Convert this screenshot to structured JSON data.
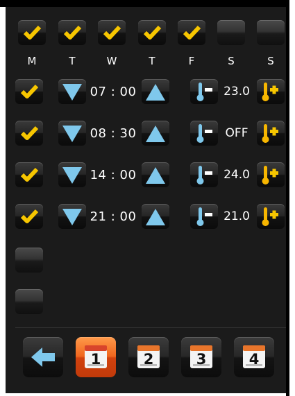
{
  "days": [
    "M",
    "T",
    "W",
    "T",
    "F",
    "S",
    "S"
  ],
  "day_checked": [
    true,
    true,
    true,
    true,
    true,
    false,
    false
  ],
  "schedule": [
    {
      "enabled": true,
      "time": "07 : 00",
      "temp": "23.0"
    },
    {
      "enabled": true,
      "time": "08 : 30",
      "temp": "OFF"
    },
    {
      "enabled": true,
      "time": "14 : 00",
      "temp": "24.0"
    },
    {
      "enabled": true,
      "time": "21 : 00",
      "temp": "21.0"
    }
  ],
  "extra_slots_enabled": [
    false,
    false
  ],
  "tabs": [
    {
      "icon": "back-arrow-icon"
    },
    {
      "icon": "calendar-icon",
      "label": "1",
      "active": true
    },
    {
      "icon": "calendar-icon",
      "label": "2",
      "active": false
    },
    {
      "icon": "calendar-icon",
      "label": "3",
      "active": false
    },
    {
      "icon": "calendar-icon",
      "label": "4",
      "active": false
    }
  ],
  "colors": {
    "check": "#f7c600",
    "arrow": "#7fc8ec",
    "active_tab": "#e85a1a",
    "screen_bg": "#1b1b1b"
  }
}
